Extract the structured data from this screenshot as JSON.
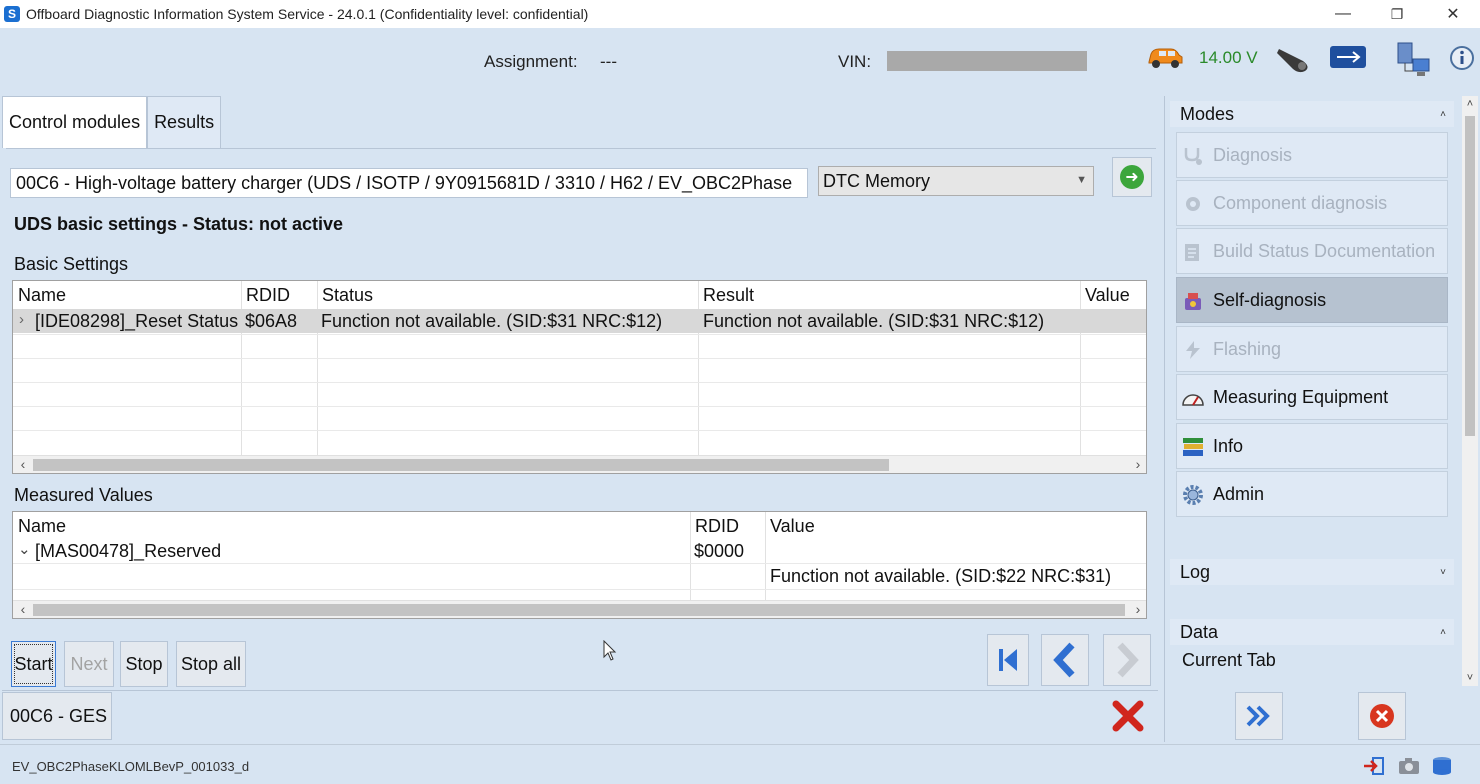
{
  "window": {
    "title": "Offboard Diagnostic Information System Service - 24.0.1 (Confidentiality level: confidential)",
    "minimize": "—",
    "restore": "❐",
    "close": "✕"
  },
  "header": {
    "assignment_label": "Assignment:",
    "assignment_value": "---",
    "vin_label": "VIN:",
    "voltage": "14.00 V"
  },
  "tabs": [
    "Control modules",
    "Results"
  ],
  "ecu": {
    "description": "00C6 - High-voltage battery charger  (UDS / ISOTP / 9Y0915681D / 3310 / H62 / EV_OBC2Phase",
    "mode_select": "DTC Memory"
  },
  "status_title": "UDS basic settings - Status: not active",
  "basic_settings": {
    "label": "Basic Settings",
    "columns": [
      "Name",
      "RDID",
      "Status",
      "Result",
      "Value"
    ],
    "rows": [
      {
        "expander": "›",
        "name": "[IDE08298]_Reset Status",
        "rdid": "$06A8",
        "status": "Function not available. (SID:$31 NRC:$12)",
        "result": "Function not available. (SID:$31 NRC:$12)",
        "value": ""
      }
    ]
  },
  "measured_values": {
    "label": "Measured Values",
    "columns": [
      "Name",
      "RDID",
      "Value"
    ],
    "rows": [
      {
        "expander": "⌄",
        "name": "[MAS00478]_Reserved",
        "rdid": "$0000",
        "value": ""
      },
      {
        "expander": "",
        "name": "",
        "rdid": "",
        "value": "Function not available. (SID:$22 NRC:$31)"
      }
    ]
  },
  "buttons": {
    "start": "Start",
    "next": "Next",
    "stop": "Stop",
    "stop_all": "Stop all"
  },
  "bottom_tab": "00C6 - GES",
  "right_panel": {
    "modes_header": "Modes",
    "modes": [
      {
        "label": "Diagnosis",
        "icon": "stethoscope-icon",
        "state": "disabled"
      },
      {
        "label": "Component diagnosis",
        "icon": "component-icon",
        "state": "disabled"
      },
      {
        "label": "Build Status Documentation",
        "icon": "document-icon",
        "state": "disabled"
      },
      {
        "label": "Self-diagnosis",
        "icon": "self-diagnosis-icon",
        "state": "selected"
      },
      {
        "label": "Flashing",
        "icon": "flashing-icon",
        "state": "disabled"
      },
      {
        "label": "Measuring Equipment",
        "icon": "gauge-icon",
        "state": "normal"
      },
      {
        "label": "Info",
        "icon": "books-icon",
        "state": "normal"
      },
      {
        "label": "Admin",
        "icon": "gear-icon",
        "state": "normal"
      }
    ],
    "log_header": "Log",
    "data_header": "Data",
    "current_tab_label": "Current Tab"
  },
  "footer": {
    "text": "EV_OBC2PhaseKLOMLBevP_001033_d"
  }
}
